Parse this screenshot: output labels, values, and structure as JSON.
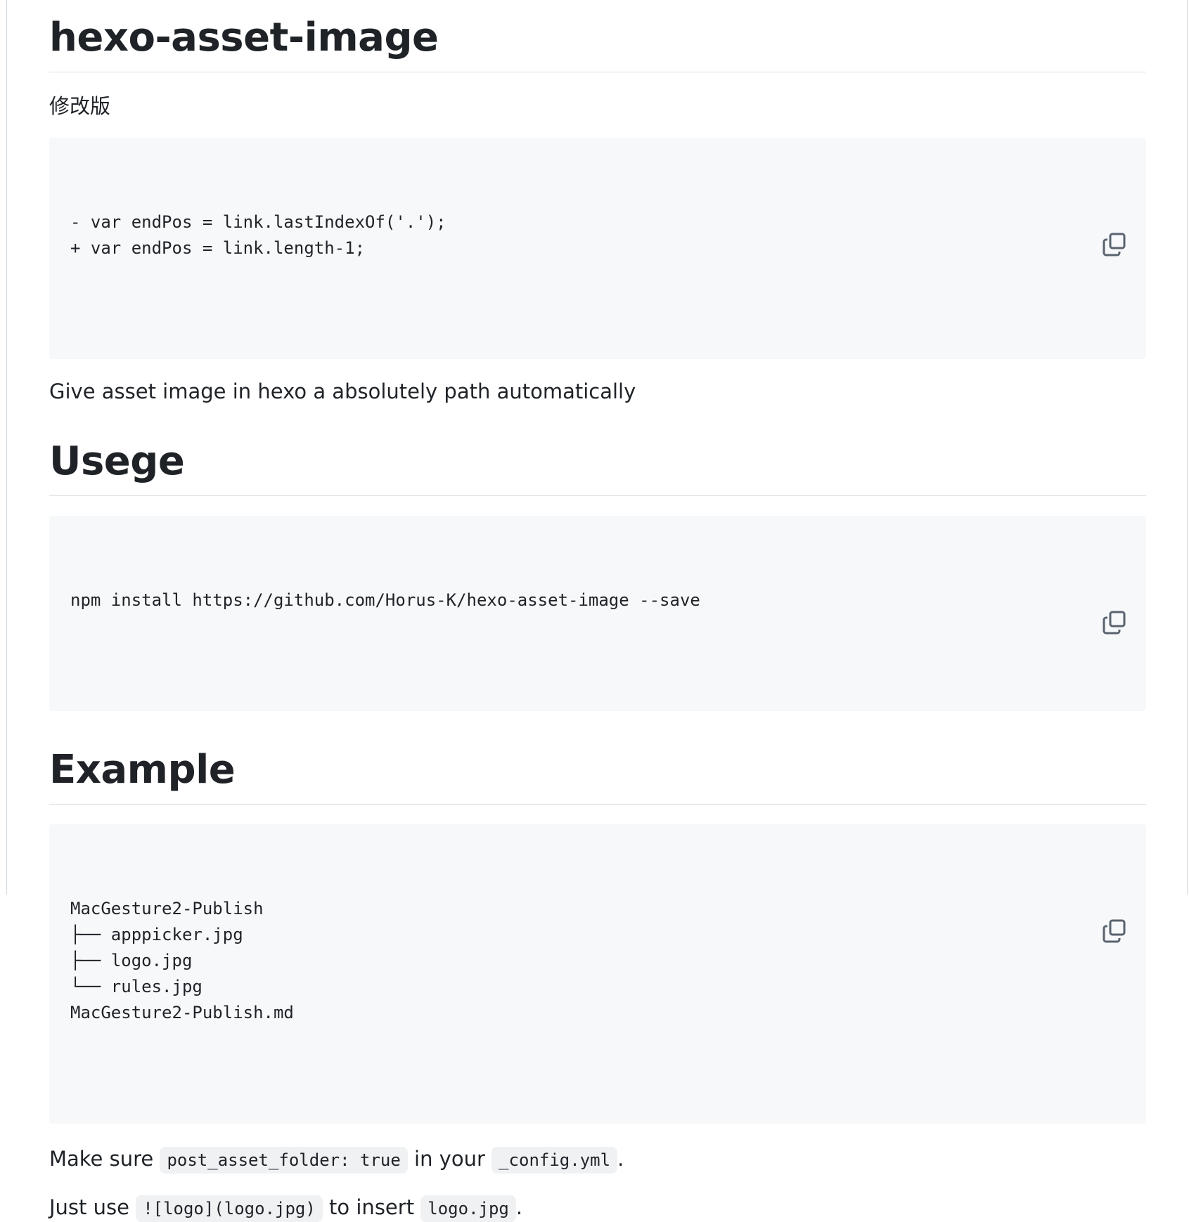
{
  "title": "hexo-asset-image",
  "subtitle_cn": "修改版",
  "diff_code": {
    "lines": [
      "- var endPos = link.lastIndexOf('.');",
      "+ var endPos = link.length-1;"
    ]
  },
  "description": "Give asset image in hexo a absolutely path automatically",
  "usage": {
    "heading": "Usege",
    "code_lines": [
      "npm install https://github.com/Horus-K/hexo-asset-image --save"
    ]
  },
  "example": {
    "heading": "Example",
    "code_lines": [
      "MacGesture2-Publish",
      "├── apppicker.jpg",
      "├── logo.jpg",
      "└── rules.jpg",
      "MacGesture2-Publish.md"
    ]
  },
  "make_sure": {
    "prefix": "Make sure ",
    "code1": "post_asset_folder: true",
    "middle": " in your ",
    "code2": "_config.yml",
    "suffix": "."
  },
  "just_use": {
    "prefix": "Just use ",
    "code1": "![logo](logo.jpg)",
    "middle": " to insert ",
    "code2": "logo.jpg",
    "suffix": "."
  },
  "icons": {
    "copy": "copy-icon"
  },
  "colors": {
    "text": "#1f2328",
    "code_bg": "#f6f8fa",
    "inline_code_bg": "#eff1f3",
    "divider": "#d8dee4",
    "icon": "#59636e"
  }
}
